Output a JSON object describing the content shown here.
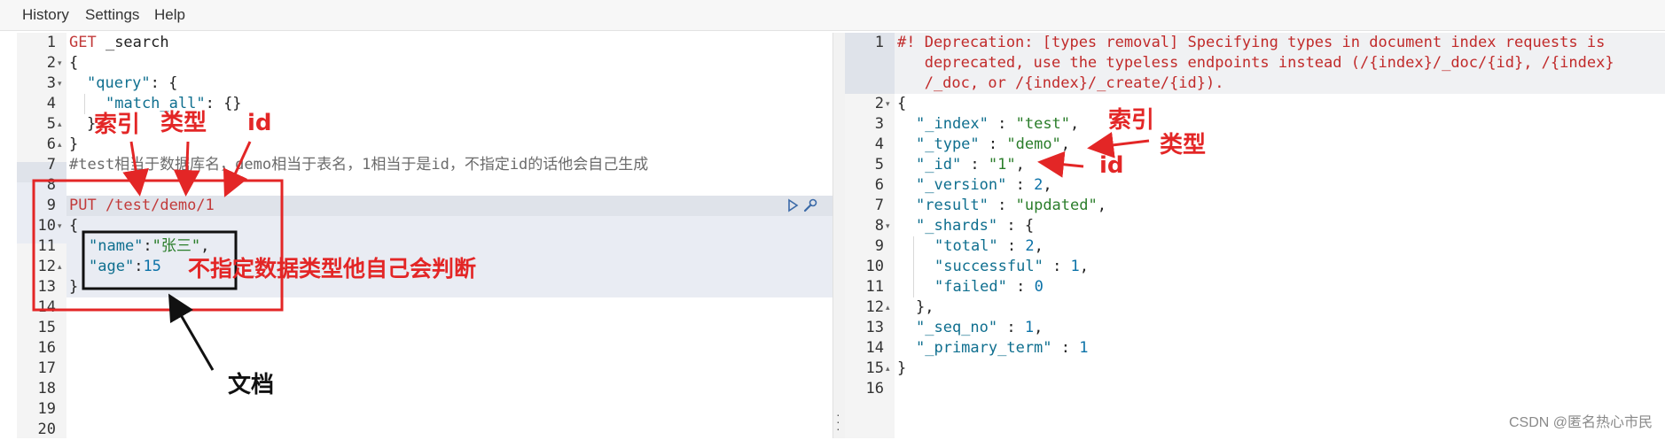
{
  "menu": {
    "history": "History",
    "settings": "Settings",
    "help": "Help"
  },
  "left": {
    "line_numbers": [
      "1",
      "2",
      "3",
      "4",
      "5",
      "6",
      "7",
      "8",
      "9",
      "10",
      "11",
      "12",
      "13",
      "14",
      "15",
      "16",
      "17",
      "18",
      "19",
      "20"
    ],
    "code": {
      "l1_method": "GET",
      "l1_path": " _search",
      "l2": "{",
      "l3_key": "\"query\"",
      "l3_rest": ": {",
      "l4_key": "\"match_all\"",
      "l4_rest": ": {}",
      "l5": "}",
      "l6": "}",
      "l7": "#test相当于数据库名，demo相当于表名，1相当于是id，不指定id的话他会自己生成",
      "l9_method": "PUT",
      "l9_path": " /test/demo/1",
      "l10": "{",
      "l11_key": "\"name\"",
      "l11_colon": ":",
      "l11_val": "\"张三\"",
      "l11_comma": ",",
      "l12_key": "\"age\"",
      "l12_colon": ":",
      "l12_val": "15",
      "l13": "}"
    }
  },
  "right": {
    "line_numbers": [
      "1",
      "2",
      "3",
      "4",
      "5",
      "6",
      "7",
      "8",
      "9",
      "10",
      "11",
      "12",
      "13",
      "14",
      "15",
      "16"
    ],
    "deprecation": [
      "#! Deprecation: [types removal] Specifying types in document index requests is",
      "   deprecated, use the typeless endpoints instead (/{index}/_doc/{id}, /{index}",
      "   /_doc, or /{index}/_create/{id})."
    ],
    "response": {
      "_index": "\"test\"",
      "_type": "\"demo\"",
      "_id": "\"1\"",
      "_version": "2",
      "result": "\"updated\"",
      "total": "2",
      "successful": "1",
      "failed": "0",
      "_seq_no": "1",
      "_primary_term": "1"
    }
  },
  "annotations": {
    "index_left": "索引",
    "type_left": "类型",
    "id_left": "id",
    "auto_type": "不指定数据类型他自己会判断",
    "document": "文档",
    "index_right": "索引",
    "type_right": "类型",
    "id_right": "id"
  },
  "watermark": "CSDN @匿名热心市民",
  "colors": {
    "annotation_red": "#e32626",
    "keyword_red": "#c23a3a",
    "json_key": "#0f6f8f",
    "json_string": "#2a7d2a",
    "json_number": "#0b72a8",
    "highlight_band": "#e9ecf3"
  }
}
